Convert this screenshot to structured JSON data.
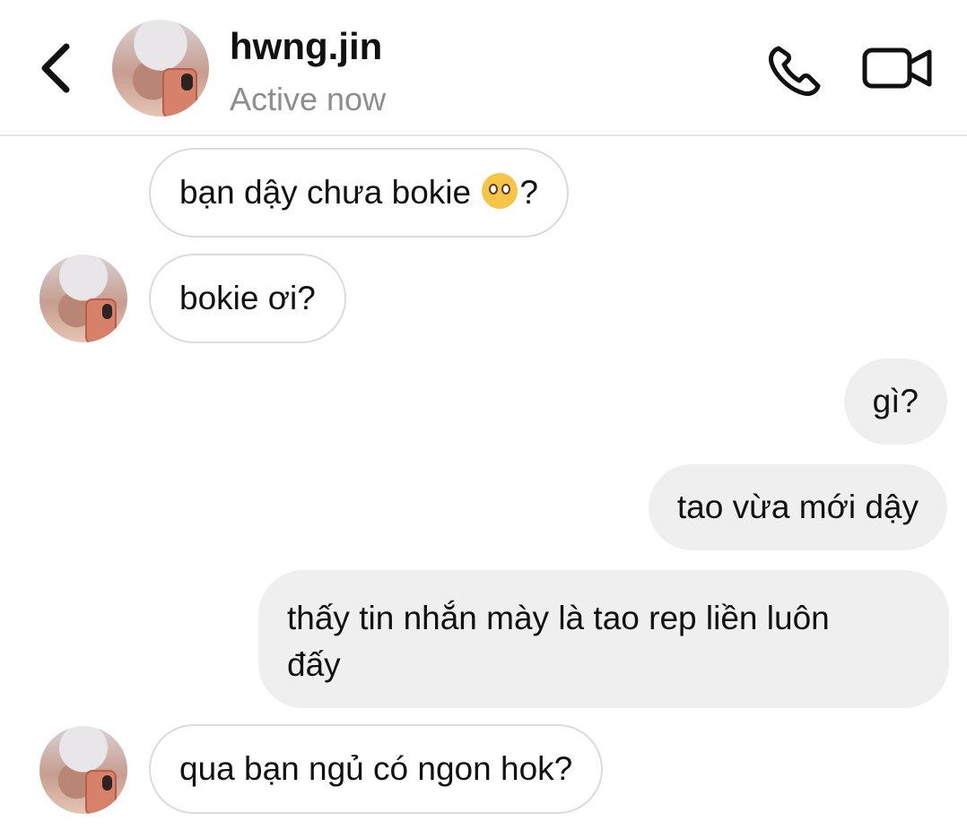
{
  "header": {
    "username": "hwng.jin",
    "status": "Active now",
    "back_icon": "chevron-left-icon",
    "call_icon": "phone-icon",
    "video_icon": "video-camera-icon"
  },
  "messages": [
    {
      "direction": "incoming",
      "text": "bạn dậy chưa bokie",
      "suffix": "?",
      "emoji": "pleading-face"
    },
    {
      "direction": "incoming",
      "text": "bokie ơi?"
    },
    {
      "direction": "outgoing",
      "text": "gì?"
    },
    {
      "direction": "outgoing",
      "text": "tao vừa mới dậy"
    },
    {
      "direction": "outgoing",
      "line1": "thấy tin nhắn mày là tao rep liền luôn",
      "line2": "đấy"
    },
    {
      "direction": "incoming",
      "text": "qua bạn ngủ có ngon hok?"
    }
  ]
}
